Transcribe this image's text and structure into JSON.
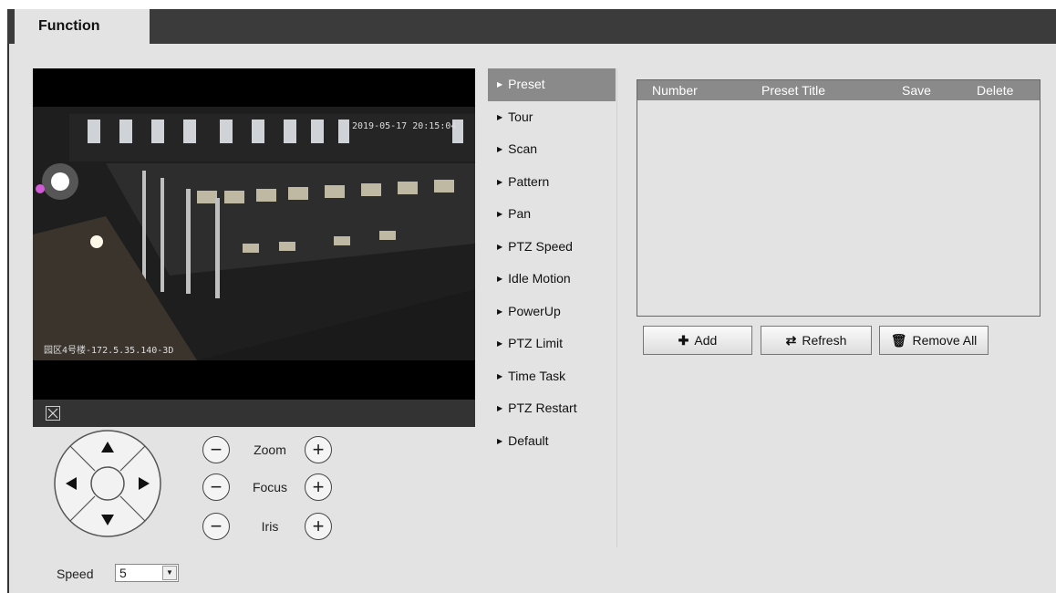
{
  "tabs": [
    {
      "label": "Function"
    }
  ],
  "video": {
    "osd_datetime": "2019-05-17 20:15:04",
    "osd_location": "园区4号楼-172.5.35.140-3D"
  },
  "ptz": {
    "zoom_label": "Zoom",
    "focus_label": "Focus",
    "iris_label": "Iris",
    "minus": "−",
    "plus": "+",
    "speed_label": "Speed",
    "speed_value": "5"
  },
  "menu": {
    "items": [
      {
        "label": "Preset"
      },
      {
        "label": "Tour"
      },
      {
        "label": "Scan"
      },
      {
        "label": "Pattern"
      },
      {
        "label": "Pan"
      },
      {
        "label": "PTZ Speed"
      },
      {
        "label": "Idle Motion"
      },
      {
        "label": "PowerUp"
      },
      {
        "label": "PTZ Limit"
      },
      {
        "label": "Time Task"
      },
      {
        "label": "PTZ Restart"
      },
      {
        "label": "Default"
      }
    ],
    "active": "Preset"
  },
  "preset_table": {
    "columns": [
      "Number",
      "Preset Title",
      "Save",
      "Delete"
    ],
    "rows": []
  },
  "buttons": {
    "add": "Add",
    "refresh": "Refresh",
    "remove_all": "Remove All"
  },
  "icons": {
    "add": "plus-icon",
    "refresh": "refresh-icon",
    "remove_all": "trash-icon",
    "fit": "fit-window-icon"
  },
  "colors": {
    "top_bar": "#3b3b3b",
    "panel": "#e3e3e3",
    "active_menu": "#8a8a8a",
    "table_header": "#8a8a8a"
  }
}
